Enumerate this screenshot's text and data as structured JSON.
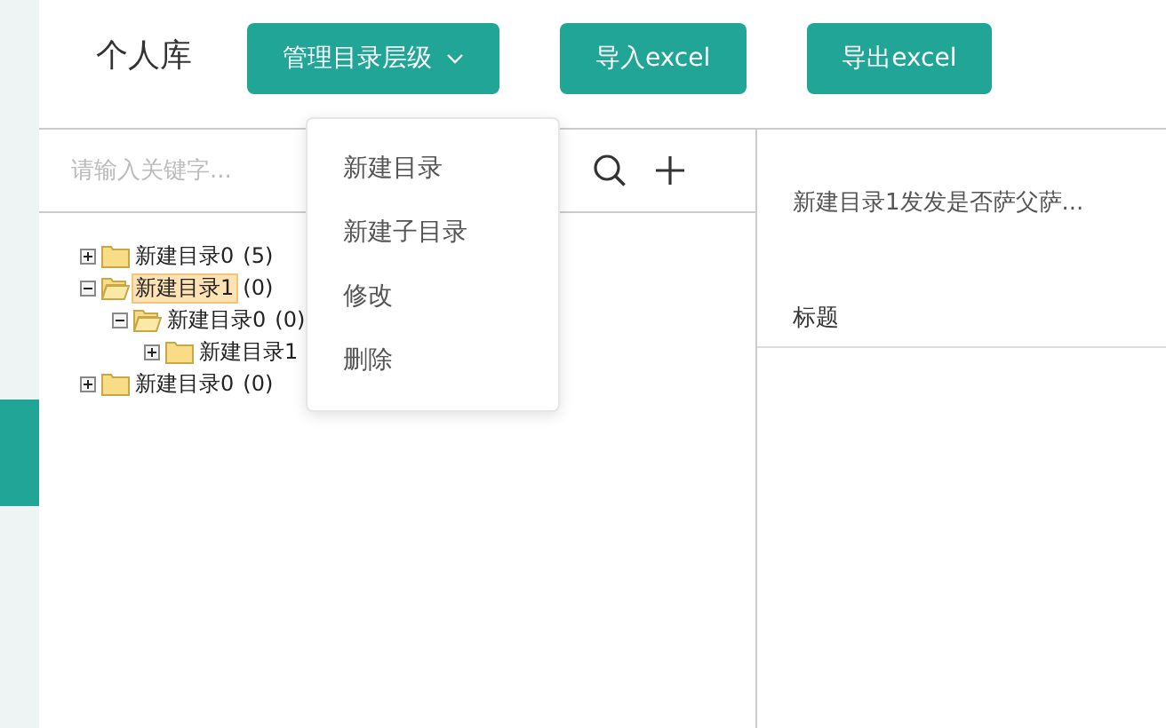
{
  "header": {
    "title": "个人库",
    "buttons": [
      {
        "label": "管理目录层级",
        "kind": "dropdown"
      },
      {
        "label": "导入excel",
        "kind": "plain"
      },
      {
        "label": "导出excel",
        "kind": "plain"
      }
    ]
  },
  "menu": {
    "items": [
      "新建目录",
      "新建子目录",
      "修改",
      "删除"
    ]
  },
  "search": {
    "placeholder": "请输入关键字..."
  },
  "tree": [
    {
      "label": "新建目录0",
      "count": "(5)",
      "expanded": false,
      "selected": false
    },
    {
      "label": "新建目录1",
      "count": "(0)",
      "expanded": true,
      "selected": true,
      "children": [
        {
          "label": "新建目录0",
          "count": "(0)",
          "expanded": true,
          "selected": false,
          "children": [
            {
              "label": "新建目录1",
              "expanded": false,
              "selected": false
            }
          ]
        }
      ]
    },
    {
      "label": "新建目录0",
      "count": "(0)",
      "expanded": false,
      "selected": false
    }
  ],
  "detail": {
    "summary": "新建目录1发发是否萨父萨...",
    "column": "标题"
  }
}
